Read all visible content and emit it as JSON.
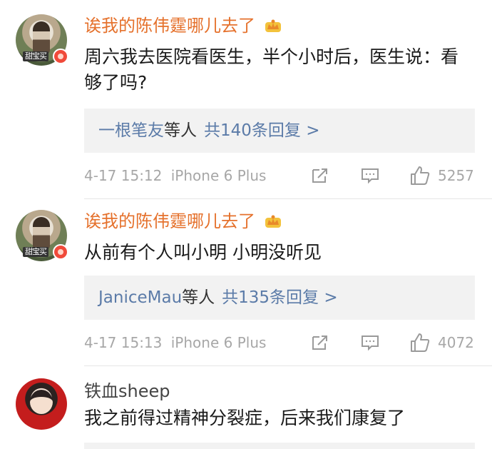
{
  "comments": [
    {
      "username": "诶我的陈伟霆哪儿去了",
      "avatar_tag": "甜宝买",
      "text": "周六我去医院看医生，半个小时后，医生说：看够了吗?",
      "reply_users": "一根笔友",
      "reply_etc": "等人",
      "reply_count": "共140条回复 >",
      "time": "4-17 15:12",
      "device": "iPhone 6 Plus",
      "likes": "5257"
    },
    {
      "username": "诶我的陈伟霆哪儿去了",
      "avatar_tag": "甜宝买",
      "text": "从前有个人叫小明 小明没听见",
      "reply_users": "JaniceMau",
      "reply_etc": "等人",
      "reply_count": "共135条回复 >",
      "time": "4-17 15:13",
      "device": "iPhone 6 Plus",
      "likes": "4072"
    },
    {
      "username": "铁血sheep",
      "text": "我之前得过精神分裂症，后来我们康复了"
    }
  ],
  "colors": {
    "vip_name": "#e5712c",
    "link_blue": "#5b7ba8",
    "meta_gray": "#a7a7a7",
    "reply_bg": "#f2f2f2"
  },
  "icons": [
    "crown-icon",
    "share-icon",
    "comment-icon",
    "like-icon",
    "verified-badge-icon"
  ]
}
